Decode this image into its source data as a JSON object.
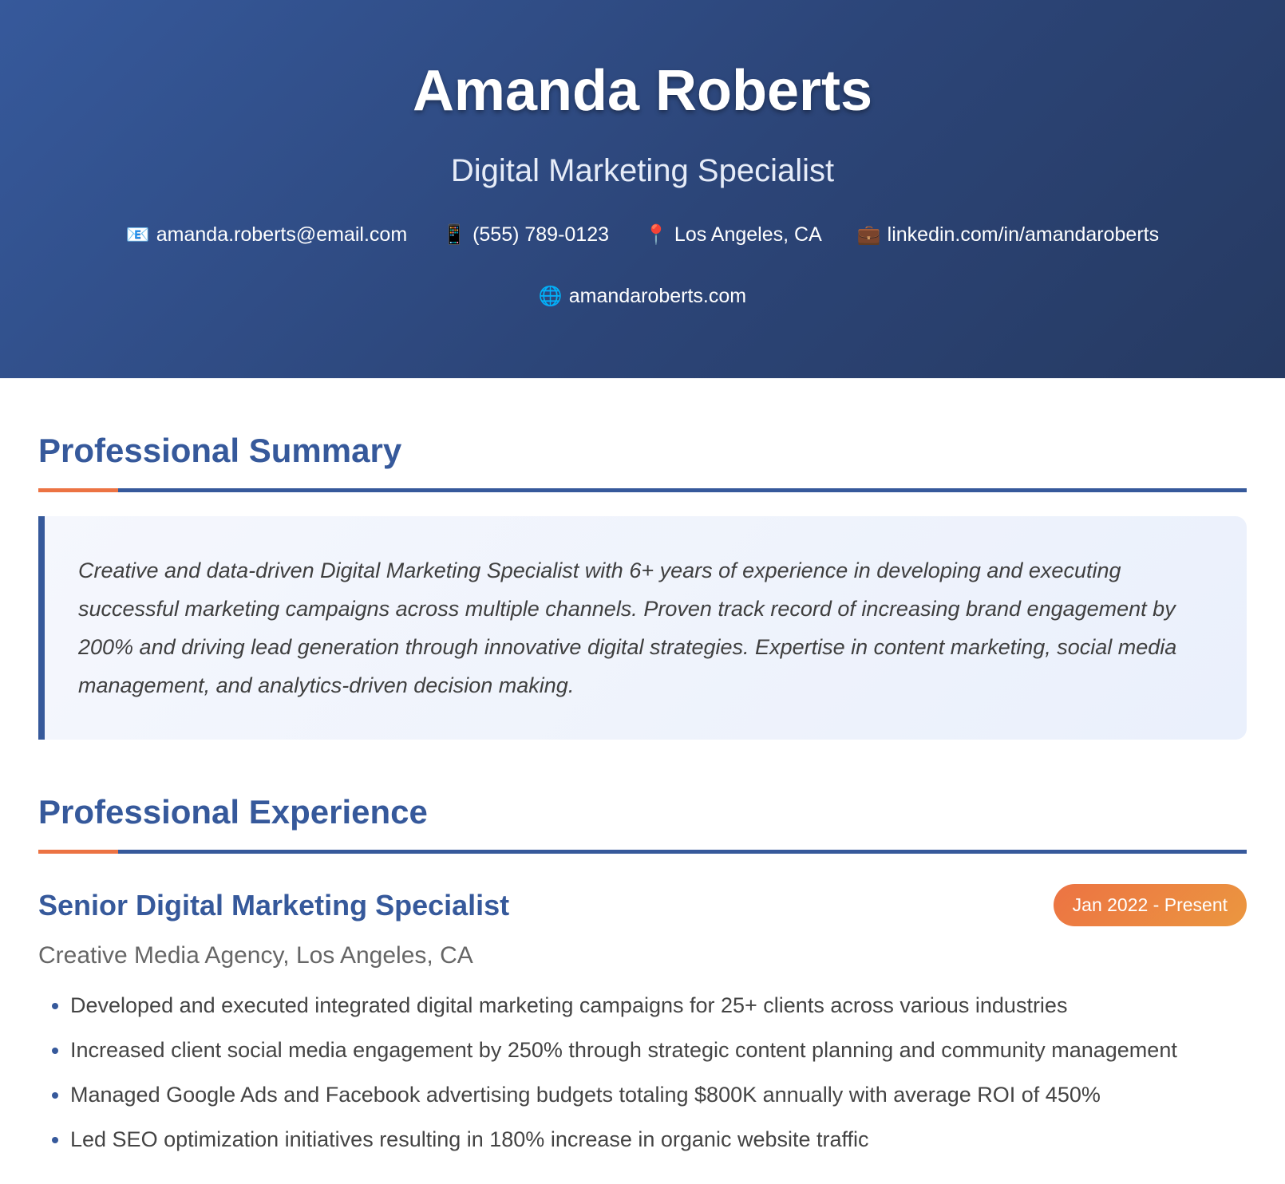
{
  "header": {
    "name": "Amanda Roberts",
    "title": "Digital Marketing Specialist",
    "contacts": [
      {
        "icon": "email-icon",
        "glyph": "📧",
        "text": "amanda.roberts@email.com"
      },
      {
        "icon": "phone-icon",
        "glyph": "📱",
        "text": "(555) 789-0123"
      },
      {
        "icon": "location-pin-icon",
        "glyph": "📍",
        "text": "Los Angeles, CA"
      },
      {
        "icon": "briefcase-icon",
        "glyph": "💼",
        "text": "linkedin.com/in/amandaroberts"
      },
      {
        "icon": "globe-icon",
        "glyph": "🌐",
        "text": "amandaroberts.com"
      }
    ]
  },
  "summary": {
    "heading": "Professional Summary",
    "text": "Creative and data-driven Digital Marketing Specialist with 6+ years of experience in developing and executing successful marketing campaigns across multiple channels. Proven track record of increasing brand engagement by 200% and driving lead generation through innovative digital strategies. Expertise in content marketing, social media management, and analytics-driven decision making."
  },
  "experience": {
    "heading": "Professional Experience",
    "jobs": [
      {
        "title": "Senior Digital Marketing Specialist",
        "dates": "Jan 2022 - Present",
        "company": "Creative Media Agency, Los Angeles, CA",
        "bullets": [
          "Developed and executed integrated digital marketing campaigns for 25+ clients across various industries",
          "Increased client social media engagement by 250% through strategic content planning and community management",
          "Managed Google Ads and Facebook advertising budgets totaling $800K annually with average ROI of 450%",
          "Led SEO optimization initiatives resulting in 180% increase in organic website traffic"
        ]
      }
    ]
  }
}
